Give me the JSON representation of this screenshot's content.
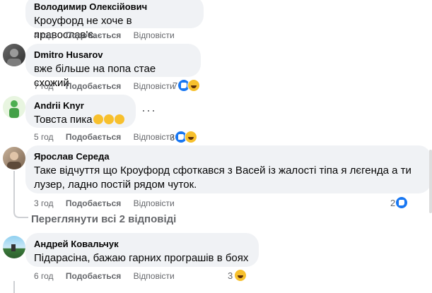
{
  "comments": [
    {
      "author": "Володимир Олексійович",
      "text": "Кроуфорд не хоче в православ'є.",
      "time": "4 год",
      "like_label": "Подобається",
      "reply_label": "Відповісти",
      "reactions": ""
    },
    {
      "author": "Dmitro Husarov",
      "text": "вже більше на попа стае схожий",
      "time": "7 год",
      "like_label": "Подобається",
      "reply_label": "Відповісти",
      "reactions": "7"
    },
    {
      "author": "Andrii Knyr",
      "text": "Товста пика",
      "time": "5 год",
      "like_label": "Подобається",
      "reply_label": "Відповісти",
      "reactions": "3"
    },
    {
      "author": "Ярослав Середа",
      "text": "Таке відчуття що Кроуфорд сфоткався з Васей із жалості тіпа я лєгенда а ти лузер, ладно постій рядом чуток.",
      "time": "3 год",
      "like_label": "Подобається",
      "reply_label": "Відповісти",
      "reactions": "2"
    },
    {
      "author": "Андрей Ковальчук",
      "text": "Підарасіна, бажаю гарних програшів в боях",
      "time": "6 год",
      "like_label": "Подобається",
      "reply_label": "Відповісти",
      "reactions": "3"
    }
  ],
  "view_replies": "Переглянути всі 2 відповіді",
  "colors": {
    "bubble": "#f0f2f5",
    "meta": "#65676b",
    "like": "#1877f2",
    "haha": "#f7c02d"
  }
}
